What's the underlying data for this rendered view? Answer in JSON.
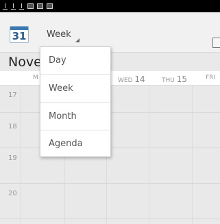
{
  "status_bar": {
    "icons": [
      "download-icon",
      "download-icon",
      "download-icon",
      "image-icon",
      "mail-icon",
      "sdcard-icon"
    ]
  },
  "action_bar": {
    "app_icon_number": "31",
    "view_selected": "Week"
  },
  "calendar": {
    "month_title": "Nove",
    "days": [
      {
        "abbr": "M",
        "num": ""
      },
      {
        "abbr": "WED",
        "num": "14"
      },
      {
        "abbr": "THU",
        "num": "15"
      },
      {
        "abbr": "FRI",
        "num": ""
      }
    ],
    "hours": [
      "17",
      "18",
      "19",
      "20"
    ]
  },
  "dropdown": {
    "options": [
      "Day",
      "Week",
      "Month",
      "Agenda"
    ]
  },
  "colors": {
    "status_bar": "#000000",
    "action_bar": "#f1f1f1",
    "grid_bg": "#e9e9e9",
    "accent": "#3a79b4"
  }
}
